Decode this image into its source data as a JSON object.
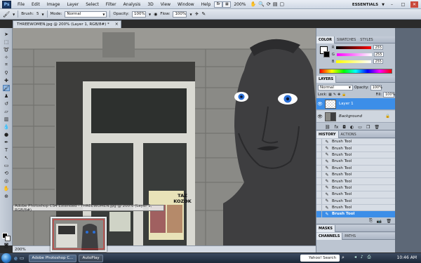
{
  "menubar": {
    "logo": "Ps",
    "items": [
      "File",
      "Edit",
      "Image",
      "Layer",
      "Select",
      "Filter",
      "Analysis",
      "3D",
      "View",
      "Window",
      "Help"
    ],
    "zoom": "200%",
    "workspace": "ESSENTIALS",
    "window_controls": [
      "–",
      "□",
      "✕"
    ]
  },
  "options": {
    "brush_label": "Brush:",
    "brush_size": "5",
    "mode_label": "Mode:",
    "mode_value": "Normal",
    "opacity_label": "Opacity:",
    "opacity_value": "100%",
    "flow_label": "Flow:",
    "flow_value": "100%"
  },
  "document": {
    "tab_title": "THREEWOMEN.jpg @ 200% (Layer 1, RGB/8#) *",
    "tab_close": "×",
    "status_zoom": "200%",
    "window_caption": "Adobe Photoshop CS4 Extended - THREEWOMEN.jpg @ 200% (Layer 1, RGB/8#)",
    "poster_text": "TAZ KOZOK"
  },
  "color_panel": {
    "tabs": [
      "COLOR",
      "SWATCHES",
      "STYLES"
    ],
    "channels": [
      {
        "label": "R",
        "value": "255"
      },
      {
        "label": "G",
        "value": "255"
      },
      {
        "label": "B",
        "value": "255"
      }
    ]
  },
  "layers_panel": {
    "tabs": [
      "LAYERS"
    ],
    "blend_mode": "Normal",
    "opacity_label": "Opacity:",
    "opacity_value": "100%",
    "fill_label": "Fill:",
    "fill_value": "100%",
    "layers": [
      {
        "name": "Layer 1",
        "selected": true
      },
      {
        "name": "Background",
        "selected": false
      }
    ]
  },
  "history_panel": {
    "tabs": [
      "HISTORY",
      "ACTIONS"
    ],
    "items": [
      "Brush Tool",
      "Brush Tool",
      "Brush Tool",
      "Brush Tool",
      "Brush Tool",
      "Brush Tool",
      "Brush Tool",
      "Brush Tool",
      "Brush Tool",
      "Brush Tool",
      "Brush Tool",
      "Brush Tool"
    ]
  },
  "collapsed_panels": {
    "masks": "MASKS",
    "channels_tabs": [
      "CHANNELS",
      "PATHS"
    ]
  },
  "taskbar": {
    "tasks": [
      "Adobe Photoshop C...",
      "AutoPlay"
    ],
    "search_placeholder": "Yahoo! Search",
    "clock": "10:46 AM"
  },
  "colors": {
    "accent": "#3c8ee8",
    "statue": "#3e3e40",
    "eye_iris": "#2a6fd6"
  }
}
